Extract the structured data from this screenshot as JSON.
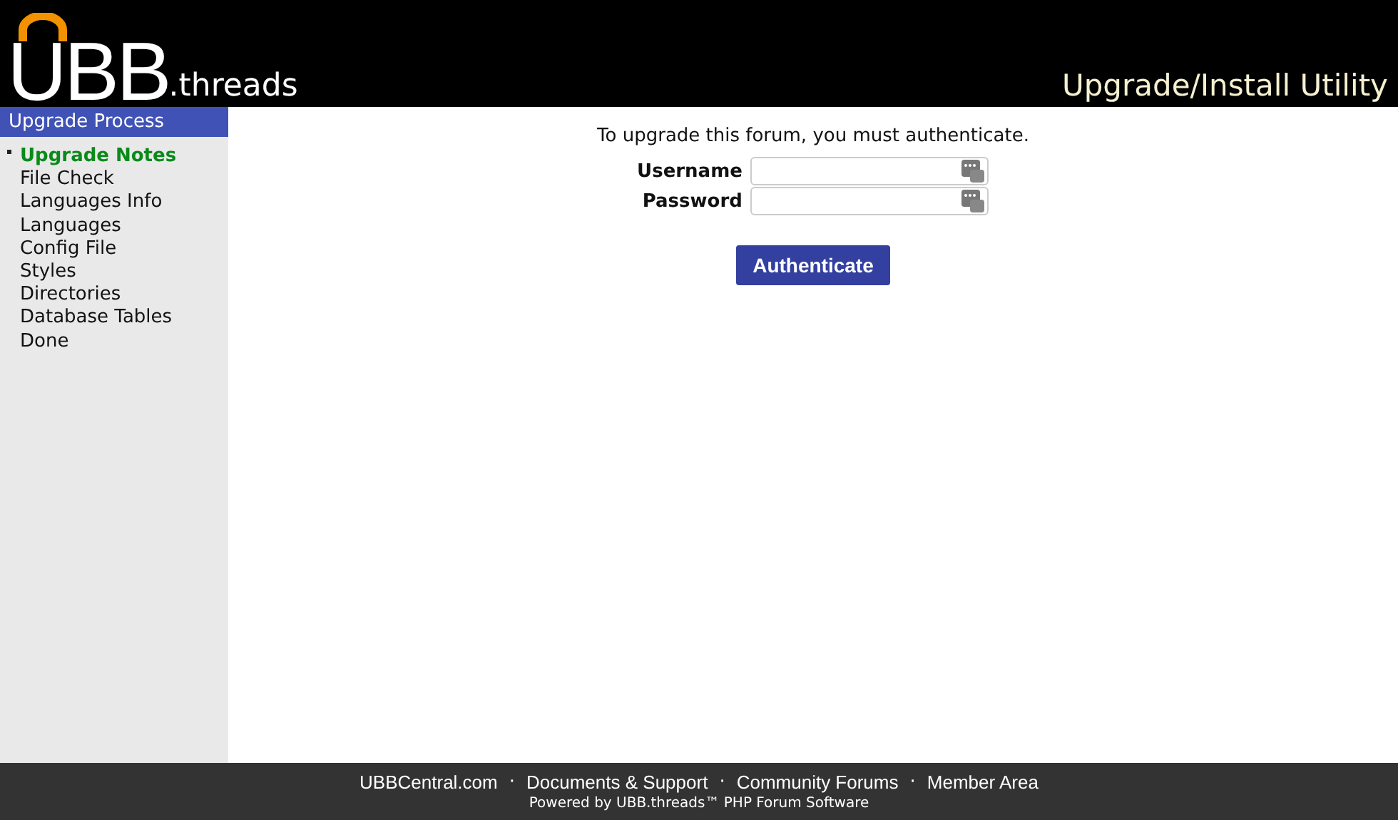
{
  "header": {
    "logo_main": "UBB",
    "logo_suffix": ".threads",
    "title": "Upgrade/Install Utility"
  },
  "sidebar": {
    "heading": "Upgrade Process",
    "items": [
      {
        "label": "Upgrade Notes",
        "selected": true
      },
      {
        "label": "File Check",
        "selected": false
      },
      {
        "label": "Languages Info",
        "selected": false
      },
      {
        "label": "Languages",
        "selected": false
      },
      {
        "label": "Config File",
        "selected": false
      },
      {
        "label": "Styles",
        "selected": false
      },
      {
        "label": "Directories",
        "selected": false
      },
      {
        "label": "Database Tables",
        "selected": false
      },
      {
        "label": "Done",
        "selected": false
      }
    ]
  },
  "form": {
    "intro": "To upgrade this forum, you must authenticate.",
    "fields": [
      {
        "label": "Username"
      },
      {
        "label": "Password"
      }
    ],
    "button": "Authenticate"
  },
  "footer": {
    "links": [
      "UBBCentral.com",
      "Documents & Support",
      "Community Forums",
      "Member Area"
    ],
    "separator": "·",
    "powered": "Powered by UBB.threads™ PHP Forum Software"
  }
}
